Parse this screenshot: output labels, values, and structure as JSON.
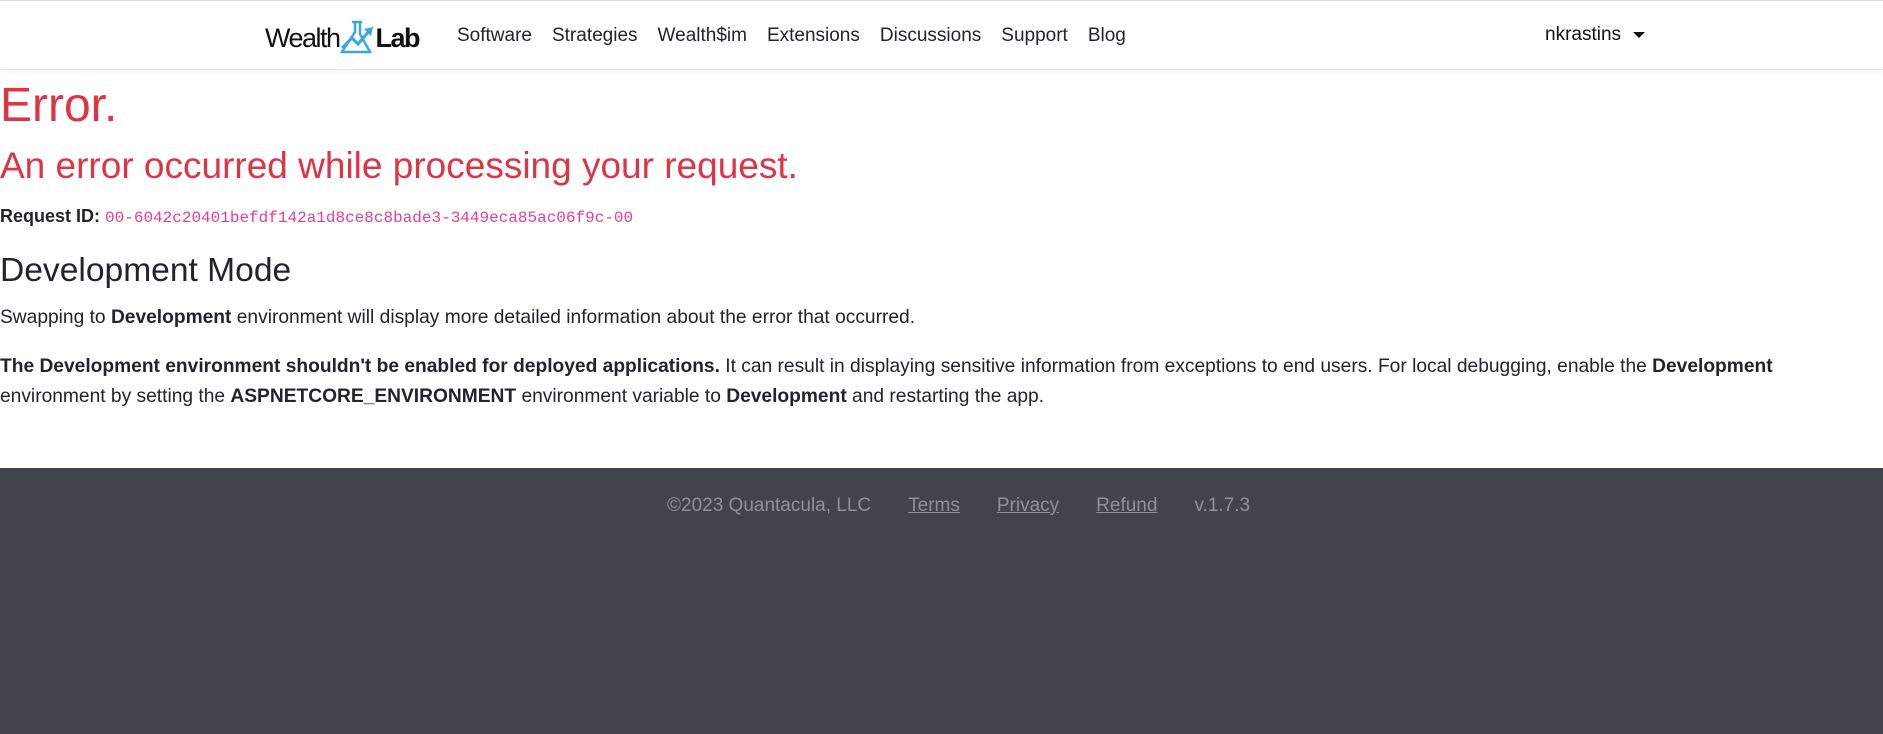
{
  "nav": {
    "logo": {
      "word1": "Wealth",
      "word2": "Lab"
    },
    "links": [
      "Software",
      "Strategies",
      "Wealth$im",
      "Extensions",
      "Discussions",
      "Support",
      "Blog"
    ],
    "user": "nkrastins",
    "colors": {
      "logo_accent": "#3aa8e0"
    }
  },
  "main": {
    "title": "Error.",
    "subtitle": "An error occurred while processing your request.",
    "request_id_label": "Request ID:",
    "request_id": "00-6042c20401befdf142a1d8ce8c8bade3-3449eca85ac06f9c-00",
    "dev_heading": "Development Mode",
    "p1": {
      "a": "Swapping to ",
      "b": "Development",
      "c": " environment will display more detailed information about the error that occurred."
    },
    "p2": {
      "a": "The Development environment shouldn't be enabled for deployed applications.",
      "b": " It can result in displaying sensitive information from exceptions to end users. For local debugging, enable the ",
      "c": "Development",
      "d": " environment by setting the ",
      "e": "ASPNETCORE_ENVIRONMENT",
      "f": " environment variable to ",
      "g": "Development",
      "h": " and restarting the app."
    },
    "colors": {
      "error": "#dc3545",
      "code": "#e83e8c"
    }
  },
  "footer": {
    "copyright": "©2023 Quantacula, LLC",
    "links": [
      "Terms",
      "Privacy",
      "Refund"
    ],
    "version": "v.1.7.3",
    "colors": {
      "bg": "#42444c"
    }
  }
}
